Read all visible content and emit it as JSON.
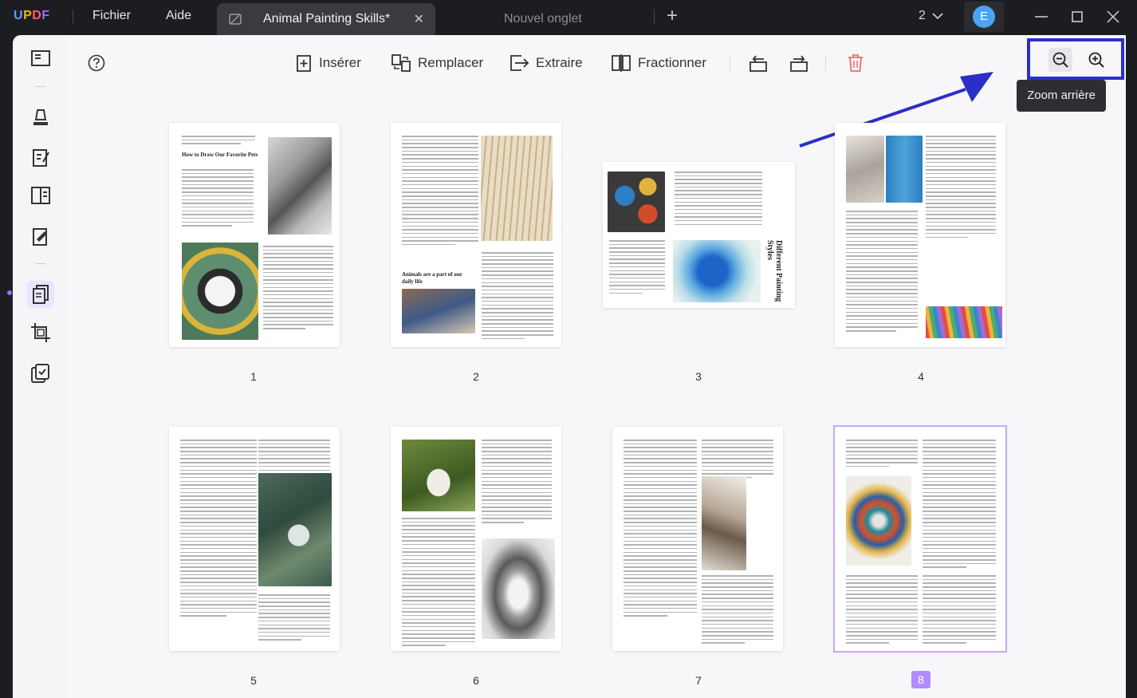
{
  "app": {
    "logo": "UPDF",
    "menu": [
      "Fichier",
      "Aide"
    ]
  },
  "tabs": {
    "active_title": "Animal Painting Skills*",
    "new_tab_label": "Nouvel onglet",
    "window_count": "2"
  },
  "user": {
    "avatar_letter": "E"
  },
  "toolbar": {
    "insert": "Insérer",
    "replace": "Remplacer",
    "extract": "Extraire",
    "split": "Fractionner",
    "tooltip": "Zoom arrière"
  },
  "pages": [
    {
      "number": "1",
      "heading": "How to Draw Our Favorite Pets",
      "heading2": "",
      "selected": false
    },
    {
      "number": "2",
      "heading": "Animals are a part of our daily life",
      "heading2": "",
      "selected": false
    },
    {
      "number": "3",
      "heading": "Different Painting Styles",
      "heading2": "",
      "selected": false
    },
    {
      "number": "4",
      "heading": "",
      "heading2": "",
      "selected": false
    },
    {
      "number": "5",
      "heading": "",
      "heading2": "",
      "selected": false
    },
    {
      "number": "6",
      "heading": "",
      "heading2": "",
      "selected": false
    },
    {
      "number": "7",
      "heading": "",
      "heading2": "",
      "selected": false
    },
    {
      "number": "8",
      "heading": "",
      "heading2": "",
      "selected": true
    }
  ],
  "colors": {
    "accent": "#9b6bff",
    "highlight_box": "#2b2fc7",
    "arrow": "#2b2fc7",
    "delete": "#f06a6a"
  }
}
